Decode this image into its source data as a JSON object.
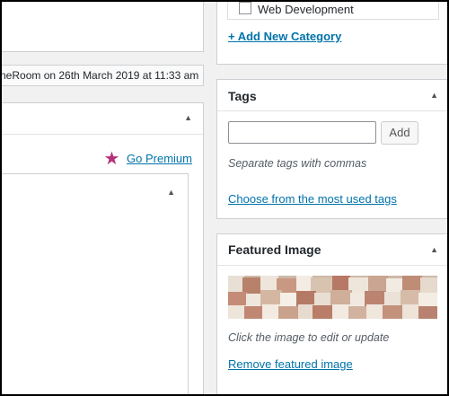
{
  "left": {
    "revision_text": "neRoom on 26th March 2019 at 11:33 am",
    "go_premium_label": "Go Premium"
  },
  "categories": {
    "last_item_label": "Web Development",
    "add_new_label": "+ Add New Category"
  },
  "tags": {
    "title": "Tags",
    "input_value": "",
    "add_button_label": "Add",
    "hint": "Separate tags with commas",
    "choose_link": "Choose from the most used tags"
  },
  "featured_image": {
    "title": "Featured Image",
    "hint": "Click the image to edit or update",
    "remove_link": "Remove featured image"
  },
  "icons": {
    "toggle": "triangle-up-icon",
    "premium": "star-icon"
  },
  "colors": {
    "link": "#0073aa",
    "star": "#b5307c",
    "border": "#ccd0d4",
    "background": "#f1f1f1"
  }
}
